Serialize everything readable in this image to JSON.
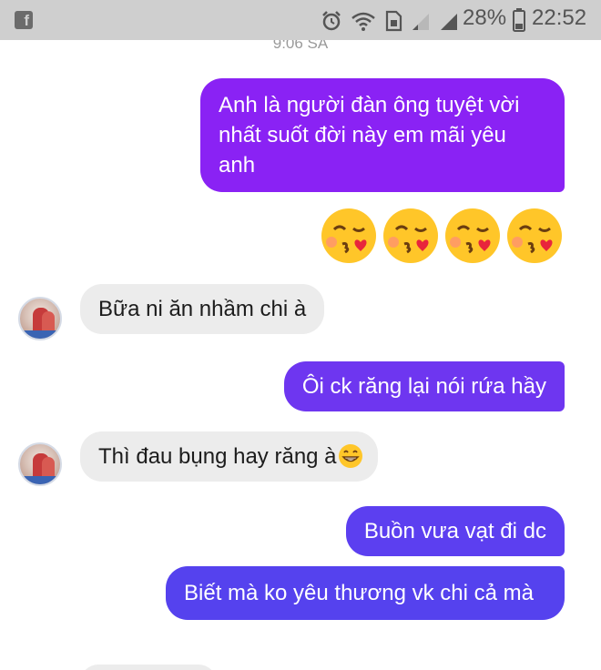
{
  "status_bar": {
    "app_icon": "facebook-icon",
    "icons": [
      "alarm-icon",
      "wifi-icon",
      "sim-icon",
      "signal-icon",
      "signal-icon",
      "battery-icon"
    ],
    "battery_percent": "28%",
    "time": "22:52"
  },
  "conversation": {
    "timestamp": "9:06 SA",
    "messages": [
      {
        "direction": "outgoing",
        "text": "Anh là người đàn ông tuyệt vời nhất suốt đời này em mãi yêu anh"
      },
      {
        "direction": "outgoing",
        "type": "emoji",
        "emoji": [
          "face-blowing-kiss",
          "face-blowing-kiss",
          "face-blowing-kiss",
          "face-blowing-kiss"
        ]
      },
      {
        "direction": "incoming",
        "text": "Bữa ni ăn nhầm chi à"
      },
      {
        "direction": "outgoing",
        "text": "Ôi ck răng lại nói rứa hầy"
      },
      {
        "direction": "incoming",
        "text": "Thì đau bụng hay răng à",
        "trailing_emoji": "grinning-face"
      },
      {
        "direction": "outgoing",
        "text": "Buồn vưa vạt đi dc"
      },
      {
        "direction": "outgoing",
        "text": "Biết mà ko yêu thương vk chi cả mà"
      }
    ]
  },
  "colors": {
    "outgoing_top": "#8a22f4",
    "outgoing_bottom": "#5542ee",
    "incoming": "#ececec",
    "status_bar": "#cfcfcf"
  }
}
